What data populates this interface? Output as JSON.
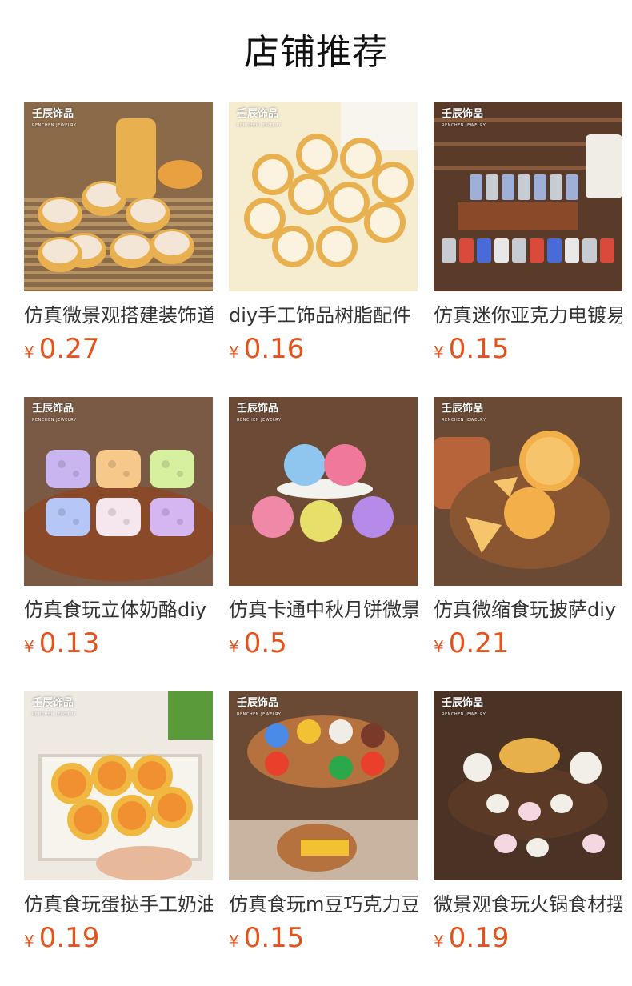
{
  "header": {
    "title": "店铺推荐"
  },
  "brand": {
    "name": "壬辰饰品",
    "sub": "RENCHEN JEWELRY"
  },
  "currency": "¥",
  "products": [
    {
      "name": "仿真微景观搭建装饰道具",
      "price": "0.27",
      "image": "dim-sum-steamers",
      "colors": [
        "#c8a06a",
        "#e9b04f",
        "#f3e3cf"
      ]
    },
    {
      "name": "diy手工饰品树脂配件",
      "price": "0.16",
      "image": "dim-sum-assorted",
      "colors": [
        "#f5e9c8",
        "#e9b04f",
        "#f7f1e3"
      ]
    },
    {
      "name": "仿真迷你亚克力电镀易拉罐",
      "price": "0.15",
      "image": "mini-bar-cans",
      "colors": [
        "#6b4a34",
        "#c7ccd3",
        "#b34a3a"
      ]
    },
    {
      "name": "仿真食玩立体奶酪diy",
      "price": "0.13",
      "image": "pastel-cheese",
      "colors": [
        "#7a4a2e",
        "#c9b6f0",
        "#f6e38a"
      ]
    },
    {
      "name": "仿真卡通中秋月饼微景观",
      "price": "0.5",
      "image": "mooncakes",
      "colors": [
        "#6c4a36",
        "#f08aa8",
        "#9fd0f0"
      ]
    },
    {
      "name": "仿真微缩食玩披萨diy",
      "price": "0.21",
      "image": "pizza-table",
      "colors": [
        "#8a5a36",
        "#f3b04a",
        "#d9402a"
      ]
    },
    {
      "name": "仿真食玩蛋挞手工奶油胶",
      "price": "0.19",
      "image": "egg-tarts",
      "colors": [
        "#f2f2ee",
        "#f0a030",
        "#e9e3d6"
      ]
    },
    {
      "name": "仿真食玩m豆巧克力豆",
      "price": "0.15",
      "image": "chocolate-candies",
      "colors": [
        "#b5713e",
        "#e8402a",
        "#f2c232"
      ]
    },
    {
      "name": "微景观食玩火锅食材摆件",
      "price": "0.19",
      "image": "hotpot",
      "colors": [
        "#5a3a26",
        "#e8b04a",
        "#f5d7e2"
      ]
    }
  ]
}
